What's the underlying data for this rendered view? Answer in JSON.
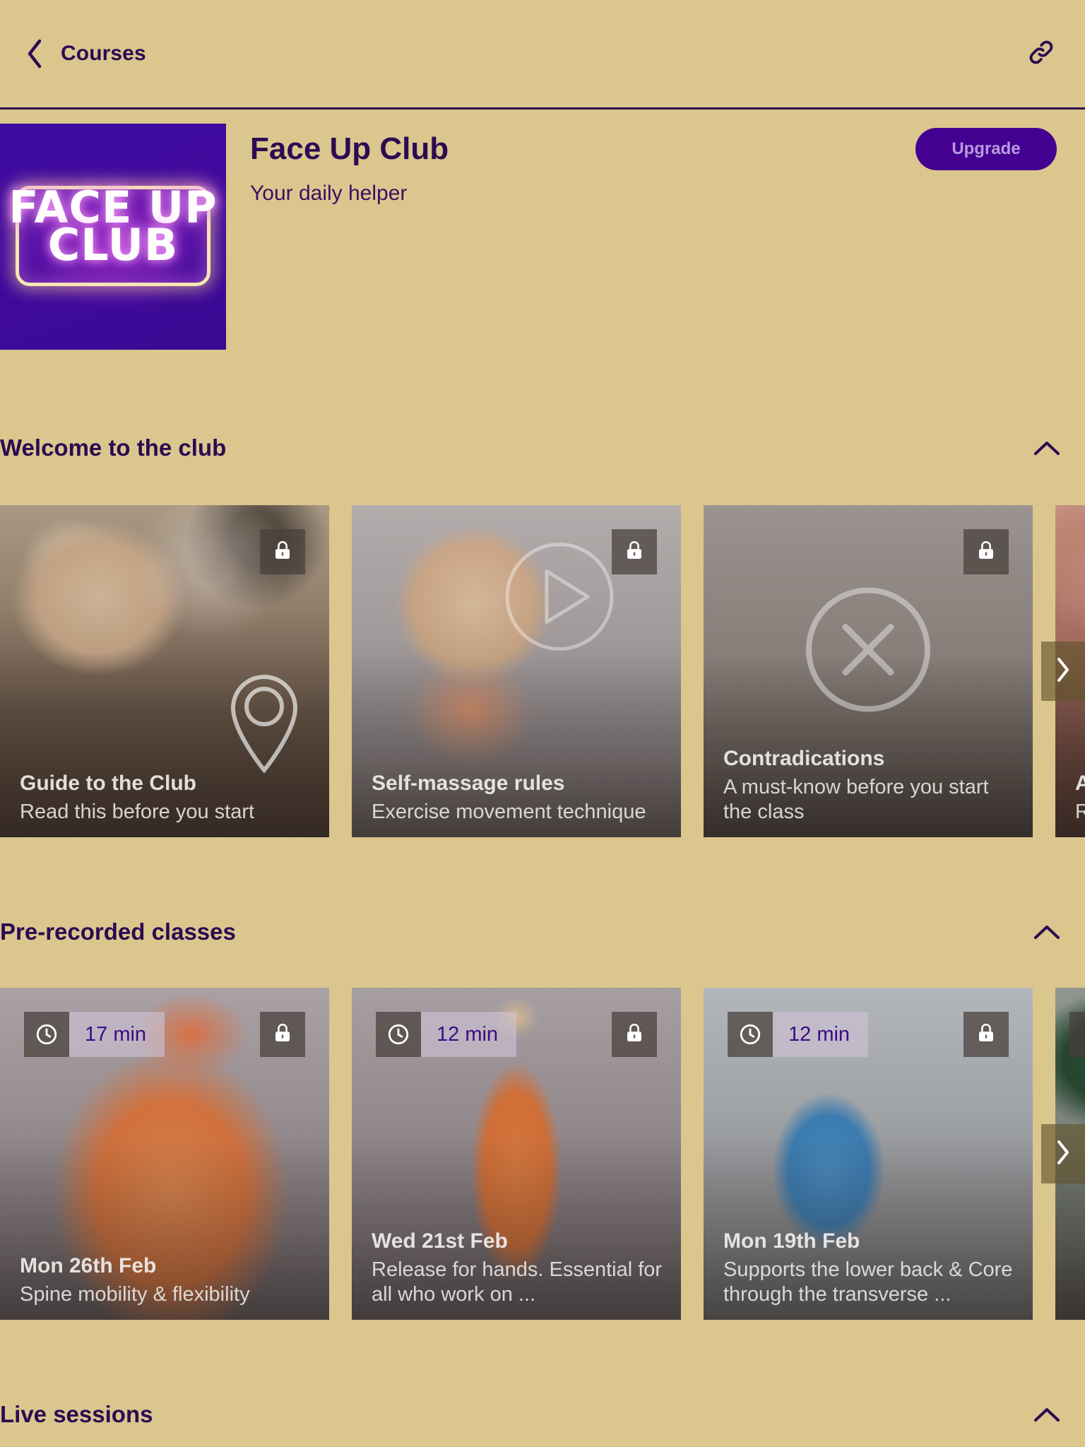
{
  "topbar": {
    "back_label": "Courses",
    "back_icon": "chevron-left-icon",
    "link_icon": "link-icon"
  },
  "course": {
    "title": "Face Up Club",
    "subtitle": "Your daily helper",
    "logo_line1": "FACE UP",
    "logo_line2": "CLUB",
    "upgrade_label": "Upgrade"
  },
  "colors": {
    "background": "#dbc68e",
    "accent_purple": "#2d0a51",
    "upgrade_bg": "#430091",
    "upgrade_text": "#b89ae0",
    "badge_text": "#3d0b86"
  },
  "sections": [
    {
      "title": "Welcome to the club",
      "collapse_icon": "chevron-up-icon",
      "next_icon": "chevron-right-icon",
      "cards": [
        {
          "title": "Guide to the Club",
          "desc": "Read this before you start",
          "lock_icon": "lock-icon",
          "overlay_icon": "map-pin-icon",
          "duration": null
        },
        {
          "title": "Self-massage rules",
          "desc": "Exercise movement technique",
          "lock_icon": "lock-icon",
          "overlay_icon": "play-circle-icon",
          "duration": null
        },
        {
          "title": "Contradications",
          "desc": "A must-know before you start the class",
          "lock_icon": "lock-icon",
          "overlay_icon": "x-circle-icon",
          "duration": null
        },
        {
          "title": "A",
          "desc": "R",
          "lock_icon": null,
          "overlay_icon": null,
          "duration": null
        }
      ]
    },
    {
      "title": "Pre-recorded classes",
      "collapse_icon": "chevron-up-icon",
      "next_icon": "chevron-right-icon",
      "cards": [
        {
          "title": "Mon 26th Feb",
          "desc": "Spine mobility & flexibility",
          "lock_icon": "lock-icon",
          "overlay_icon": null,
          "duration": "17 min",
          "duration_icon": "clock-icon"
        },
        {
          "title": "Wed 21st Feb",
          "desc": "Release for  hands. Essential for all who work on ...",
          "lock_icon": "lock-icon",
          "overlay_icon": null,
          "duration": "12 min",
          "duration_icon": "clock-icon"
        },
        {
          "title": "Mon 19th Feb",
          "desc": "Supports the lower back & Core through the transverse ...",
          "lock_icon": "lock-icon",
          "overlay_icon": null,
          "duration": "12 min",
          "duration_icon": "clock-icon"
        },
        {
          "title": "",
          "desc": "",
          "lock_icon": "lock-icon",
          "overlay_icon": null,
          "duration": null
        }
      ]
    },
    {
      "title": "Live sessions",
      "collapse_icon": "chevron-up-icon",
      "next_icon": null,
      "cards": []
    }
  ]
}
